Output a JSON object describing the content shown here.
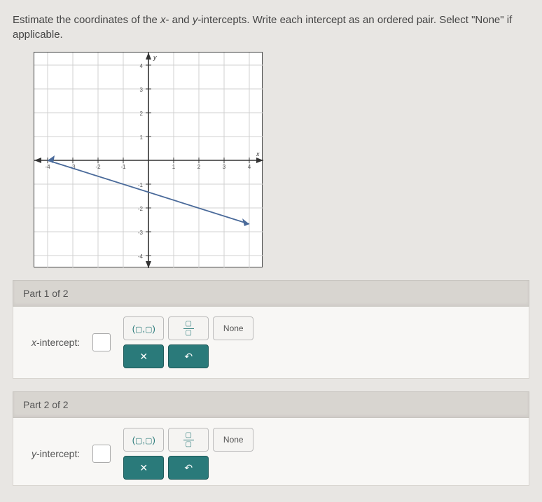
{
  "question": {
    "prefix": "Estimate the coordinates of the ",
    "var1": "x",
    "mid1": "- and ",
    "var2": "y",
    "mid2": "-intercepts. Write each intercept as an ordered pair. Select \"None\" if applicable."
  },
  "chart_data": {
    "type": "line",
    "title": "",
    "xlabel": "x",
    "ylabel": "y",
    "xlim": [
      -4,
      4
    ],
    "ylim": [
      -4,
      4
    ],
    "x_ticks": [
      -4,
      -3,
      -2,
      -1,
      0,
      1,
      2,
      3,
      4
    ],
    "y_ticks": [
      -4,
      -3,
      -2,
      -1,
      0,
      1,
      2,
      3,
      4
    ],
    "grid": true,
    "series": [
      {
        "name": "line",
        "x": [
          -4,
          4
        ],
        "y": [
          0,
          -2.67
        ],
        "color": "#4a6a9a"
      }
    ],
    "intercepts_estimated": {
      "x_intercept": [
        -4,
        0
      ],
      "y_intercept": [
        0,
        -1.33
      ]
    }
  },
  "parts": {
    "p1": {
      "header": "Part 1 of 2",
      "label_var": "x",
      "label_suffix": "-intercept:",
      "value": ""
    },
    "p2": {
      "header": "Part 2 of 2",
      "label_var": "y",
      "label_suffix": "-intercept:",
      "value": ""
    }
  },
  "palette": {
    "ordered_pair": "(▢,▢)",
    "fraction_top": "▢",
    "fraction_bot": "▢",
    "none": "None",
    "clear": "✕",
    "undo": "↶"
  }
}
